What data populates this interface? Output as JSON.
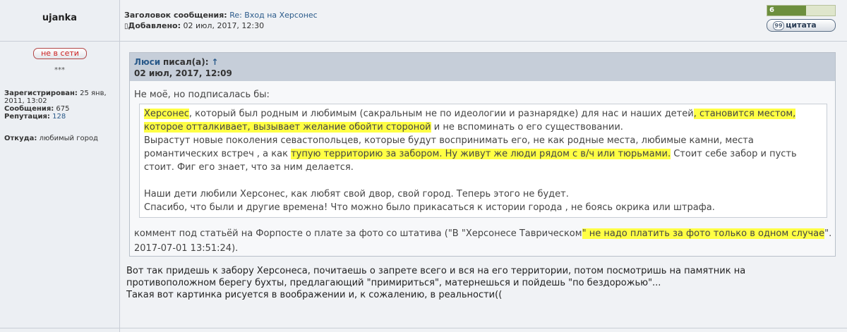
{
  "user": {
    "name": "ujanka",
    "status": "не в сети",
    "stars": "***",
    "registered_label": "Зарегистрирован:",
    "registered_value": "25 янв, 2011, 13:02",
    "messages_label": "Сообщения:",
    "messages_value": "675",
    "reputation_label": "Репутация:",
    "reputation_value": "128",
    "from_label": "Откуда:",
    "from_value": "любимый город"
  },
  "header": {
    "subject_label": "Заголовок сообщения:",
    "subject_value": "Re: Вход на Херсонес",
    "added_label": "Добавлено:",
    "added_value": "02 июл, 2017, 12:30",
    "rating": "6",
    "rating_fill": 0.57,
    "quote_button": "цитата"
  },
  "quote": {
    "author": "Люси",
    "wrote": "писал(а):",
    "arrow": "↑",
    "date": "02 июл, 2017, 12:09",
    "intro": "Не моё, но подписалась бы:",
    "p1_hl1": "Херсонес",
    "p1_t1": ", который был родным и любимым (сакральным не по идеологии и разнарядке) для нас и наших детей",
    "p1_hl2": ", становится местом, которое отталкивает, вызывает желание обойти стороной",
    "p1_t2": " и не вспоминать о его существовании.",
    "p2_t1": "Вырастут новые поколения севастопольцев, которые будут воспринимать его, не как родные места, любимые камни, места романтических встреч , а как ",
    "p2_hl": "тупую территорию за забором. Ну живут же люди рядом с в/ч или тюрьмами.",
    "p2_t2": " Стоит себе забор и пусть стоит. Фиг его знает, что за ним делается.",
    "p3": "Наши дети любили Херсонес, как любят свой двор, свой город. Теперь этого не будет.",
    "p4": "Спасибо, что были и другие времена! Что можно было прикасаться к истории города , не боясь окрика или штрафа.",
    "after_t1": "коммент под статьёй на Форпосте о плате за фото со штатива (\"В \"Херсонесе Таврическом",
    "after_hl": "\" не надо платить за фото только в одном случае",
    "after_t2": "\". 2017-07-01 13:51:24)."
  },
  "post": {
    "line1": "Вот так придешь к забору Херсонеса, почитаешь о запрете всего и вся на его территории, потом посмотришь на памятник на",
    "line2": "противоположном берегу бухты, предлагающий \"примириться\", матернешься и пойдешь \"по бездорожью\"...",
    "line3": "Такая вот картинка рисуется в воображении и, к сожалению, в реальности(("
  }
}
